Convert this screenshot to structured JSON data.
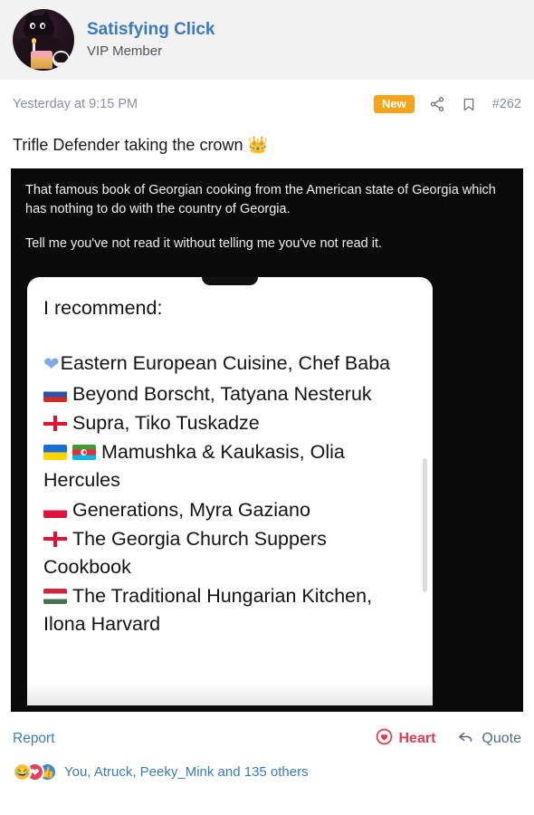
{
  "header": {
    "username": "Satisfying Click",
    "user_title": "VIP Member",
    "avatar_name": "dark-cat-with-cake-avatar"
  },
  "meta": {
    "timestamp": "Yesterday at 9:15 PM",
    "badge": "New",
    "share_icon": "share-icon",
    "bookmark_icon": "bookmark-icon",
    "post_number": "#262"
  },
  "post": {
    "title": "Trifle Defender taking the crown",
    "title_emoji": "👑"
  },
  "embed": {
    "caption_line_1": "That famous book of Georgian cooking from the American state of Georgia which has nothing to do with the country of Georgia.",
    "caption_line_2": "Tell me you've not read it without telling me you've not read it.",
    "card": {
      "heading": "I recommend:",
      "items": [
        {
          "flag": "blue-heart",
          "text": "Eastern European Cuisine, Chef Baba"
        },
        {
          "flag": "ru",
          "text": "Beyond Borscht, Tatyana Nesteruk"
        },
        {
          "flag": "ge",
          "text": "Supra, Tiko Tuskadze"
        },
        {
          "flag": "ua-az",
          "text": "Mamushka & Kaukasis, Olia Hercules"
        },
        {
          "flag": "pl",
          "text": "Generations, Myra Gaziano"
        },
        {
          "flag": "ge",
          "text": "The Georgia Church Suppers Cookbook"
        },
        {
          "flag": "hu",
          "text": "The Traditional Hungarian Kitchen, Ilona Harvard"
        }
      ]
    }
  },
  "footer": {
    "report_label": "Report",
    "heart_label": "Heart",
    "heart_icon": "heart-circle-icon",
    "quote_label": "Quote",
    "quote_icon": "reply-arrow-icon"
  },
  "reactions": {
    "icons": [
      "laugh-reaction-icon",
      "love-reaction-icon",
      "like-reaction-icon"
    ],
    "text": "You, Atruck, Peeky_Mink and 135 others"
  },
  "colors": {
    "link_blue": "#3a7ac0",
    "badge_orange": "#f5a41c",
    "heart_red": "#e33b4e",
    "header_gray": "#f2f2f2"
  }
}
